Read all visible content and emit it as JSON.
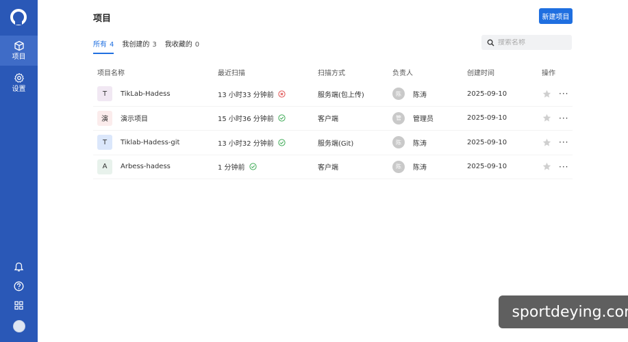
{
  "sidebar": {
    "nav": [
      {
        "label": "项目",
        "icon": "cube-icon"
      },
      {
        "label": "设置",
        "icon": "gear-icon"
      }
    ],
    "bottom_icons": [
      "bell-icon",
      "help-icon",
      "apps-grid-icon",
      "user-avatar"
    ]
  },
  "header": {
    "title": "项目",
    "new_button": "新建项目"
  },
  "tabs": [
    {
      "label": "所有",
      "count": "4"
    },
    {
      "label": "我创建的",
      "count": "3"
    },
    {
      "label": "我收藏的",
      "count": "0"
    }
  ],
  "search": {
    "placeholder": "搜索名称"
  },
  "table": {
    "columns": [
      "项目名称",
      "最近扫描",
      "扫描方式",
      "负责人",
      "创建时间",
      "操作"
    ],
    "rows": [
      {
        "icon_text": "T",
        "icon_color": "#f1e8f3",
        "name": "TikLab-Hadess",
        "last_scan": "13 小时33 分钟前",
        "scan_status": "fail",
        "mode": "服务端(包上传)",
        "owner_avatar": "陈",
        "owner": "陈涛",
        "created": "2025-09-10"
      },
      {
        "icon_text": "演",
        "icon_color": "#fbecec",
        "name": "演示项目",
        "last_scan": "15 小时36 分钟前",
        "scan_status": "success",
        "mode": "客户端",
        "owner_avatar": "管",
        "owner": "管理员",
        "created": "2025-09-10"
      },
      {
        "icon_text": "T",
        "icon_color": "#dbe7fb",
        "name": "Tiklab-Hadess-git",
        "last_scan": "13 小时32 分钟前",
        "scan_status": "success",
        "mode": "服务端(Git)",
        "owner_avatar": "陈",
        "owner": "陈涛",
        "created": "2025-09-10"
      },
      {
        "icon_text": "A",
        "icon_color": "#e8f2ec",
        "name": "Arbess-hadess",
        "last_scan": "1 分钟前",
        "scan_status": "success",
        "mode": "客户端",
        "owner_avatar": "陈",
        "owner": "陈涛",
        "created": "2025-09-10"
      }
    ]
  },
  "colors": {
    "sidebar": "#2a58b7",
    "accent": "#1f6fe0",
    "success": "#3daa55",
    "fail": "#e05252"
  },
  "watermark": "sportdeying.com"
}
